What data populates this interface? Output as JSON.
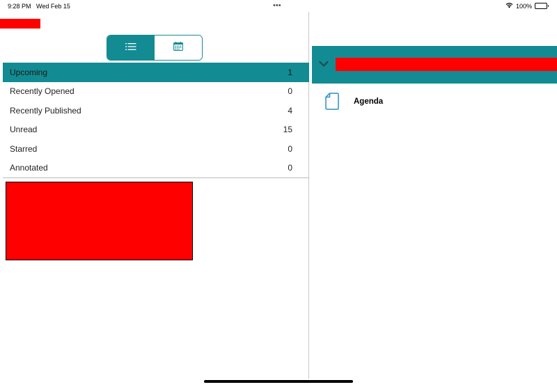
{
  "status_bar": {
    "time": "9:28 PM",
    "date": "Wed Feb 15",
    "dots": "•••",
    "battery": "100%"
  },
  "segmented_control": {
    "options": [
      "list-icon",
      "calendar-icon"
    ],
    "selected": 0
  },
  "categories": [
    {
      "label": "Upcoming",
      "count": "1",
      "selected": true
    },
    {
      "label": "Recently Opened",
      "count": "0",
      "selected": false
    },
    {
      "label": "Recently Published",
      "count": "4",
      "selected": false
    },
    {
      "label": "Unread",
      "count": "15",
      "selected": false
    },
    {
      "label": "Starred",
      "count": "0",
      "selected": false
    },
    {
      "label": "Annotated",
      "count": "0",
      "selected": false
    }
  ],
  "section": {
    "chevron_icon": "chevron-down-icon"
  },
  "documents": [
    {
      "title": "Agenda",
      "icon": "document-icon"
    }
  ],
  "colors": {
    "accent": "#138b93",
    "redacted": "#ff0000"
  }
}
